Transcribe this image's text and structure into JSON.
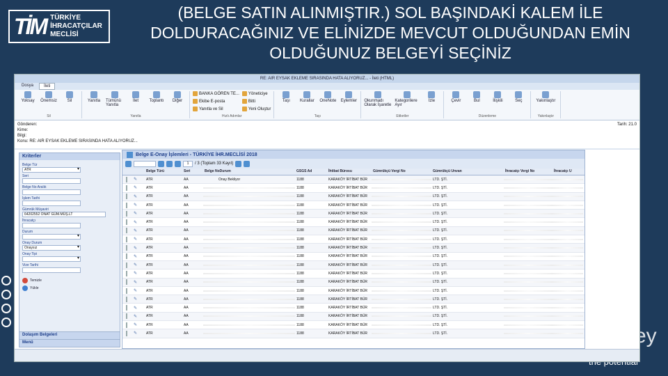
{
  "logo": {
    "mark": "TİM",
    "line1": "TÜRKİYE",
    "line2": "İHRACATÇILAR",
    "line3": "MECLİSİ"
  },
  "headline": "(BELGE SATIN ALINMIŞTIR.) SOL BAŞINDAKİ KALEM İLE DOLDURACAĞINIZ VE ELİNİZDE MEVCUT OLDUĞUNDAN EMİN OLDUĞUNUZ BELGEYİ SEÇİNİZ",
  "brand": {
    "word": "ey",
    "tagline": "the potential"
  },
  "app": {
    "window_title": "RE: AIR EYSAK EKLEME SIRASINDA HATA ALIYORUZ... - İleti (HTML)",
    "tabs": [
      {
        "label": "Dosya"
      },
      {
        "label": "İleti"
      }
    ],
    "ribbon": {
      "delete_group": {
        "label": "Sil",
        "buttons": [
          {
            "label": "Yoksay"
          },
          {
            "label": "Önemsiz"
          },
          {
            "label": "Sil"
          }
        ]
      },
      "reply_group": {
        "label": "Yanıtla",
        "buttons": [
          {
            "label": "Yanıtla"
          },
          {
            "label": "Tümünü Yanıtla"
          },
          {
            "label": "İlet"
          },
          {
            "label": "Toplantı"
          },
          {
            "label": "Diğer"
          }
        ]
      },
      "quick_group": {
        "label": "Hızlı Adımlar",
        "items": [
          "BANKA GÖREN TE...",
          "Ekibe E-posta",
          "Yanıtla ve Sil",
          "Yöneticiye",
          "Bitti",
          "Yeni Oluştur"
        ]
      },
      "move_group": {
        "label": "Taşı",
        "buttons": [
          {
            "label": "Taşı"
          },
          {
            "label": "Kurallar"
          },
          {
            "label": "OneNote"
          },
          {
            "label": "Eylemler"
          }
        ]
      },
      "tags_group": {
        "label": "Etiketler",
        "buttons": [
          {
            "label": "Okunmadı Olarak İşaretle"
          },
          {
            "label": "Kategorilere Ayır"
          },
          {
            "label": "İzle"
          }
        ]
      },
      "edit_group": {
        "label": "Düzenleme",
        "buttons": [
          {
            "label": "Çevir"
          },
          {
            "label": "Bul"
          },
          {
            "label": "İlişkili"
          },
          {
            "label": "Seç"
          }
        ]
      },
      "zoom_group": {
        "label": "Yakınlaştır",
        "buttons": [
          {
            "label": "Yakınlaştır"
          }
        ]
      }
    },
    "mail": {
      "from": "Gönderen:",
      "to": "Kime:",
      "cc": "Bilgi:",
      "subject_label": "Konu:",
      "subject": "RE: AIR EYSAK EKLEME SIRASINDA HATA ALIYORUZ...",
      "date": "Tarih: 21.0"
    },
    "left_panel": {
      "title": "Kriterler",
      "fields": [
        {
          "label": "Belge Tür",
          "value": "ATR",
          "type": "select"
        },
        {
          "label": "Seri",
          "value": "",
          "type": "input"
        },
        {
          "label": "Belge No Aralık",
          "value": "",
          "type": "input"
        },
        {
          "label": "İşlem Tarihi",
          "value": "",
          "type": "input"
        },
        {
          "label": "Gümrük Müşaviri",
          "value": "64202552 ONAT GÜM.MÜŞ.LT",
          "type": "wide"
        },
        {
          "label": "İhracatçı",
          "value": "",
          "type": "input"
        },
        {
          "label": "Durum",
          "value": "",
          "type": "select"
        },
        {
          "label": "Onay Durum",
          "value": "Onaysız",
          "type": "select"
        },
        {
          "label": "Onay Tipi",
          "value": "",
          "type": "select"
        },
        {
          "label": "Vize Tarihi",
          "value": "",
          "type": "input"
        }
      ],
      "clear_button": "Temizle",
      "load_button": "Yükle",
      "footer": [
        "Dolaşım Belgeleri",
        "Menü"
      ]
    },
    "grid": {
      "title": "Belge E-Onay İşlemleri - TÜRKİYE İHR.MECLİSİ 2018",
      "page": "1",
      "page_info": "/ 3 (Toplam 33 Kayıt)",
      "columns": [
        "",
        "",
        "Belge Türü",
        "Seri",
        "Belge No",
        "Durum",
        "GSGS Ad",
        "İhtibat Bürosu",
        "Gümrükçü Vergi No",
        "Gümrükçü Unvan",
        "İhracatçı Vergi No",
        "İhracatçı U"
      ],
      "first_row_status": "Onay Bekliyor",
      "rows": [
        {
          "type": "ATR",
          "seri": "AA",
          "gsgs": "1188",
          "buro": "KARAKÖY İRTİBAT BÜR",
          "unvan": "LTD. ŞTİ."
        },
        {
          "type": "ATR",
          "seri": "AA",
          "gsgs": "1188",
          "buro": "KARAKÖY İRTİBAT BÜR",
          "unvan": "LTD. ŞTİ."
        },
        {
          "type": "ATR",
          "seri": "AA",
          "gsgs": "1188",
          "buro": "KARAKÖY İRTİBAT BÜR",
          "unvan": "LTD. ŞTİ."
        },
        {
          "type": "ATR",
          "seri": "AA",
          "gsgs": "1188",
          "buro": "KARAKÖY İRTİBAT BÜR",
          "unvan": "LTD. ŞTİ."
        },
        {
          "type": "ATR",
          "seri": "AA",
          "gsgs": "1188",
          "buro": "KARAKÖY İRTİBAT BÜR",
          "unvan": "LTD. ŞTİ."
        },
        {
          "type": "ATR",
          "seri": "AA",
          "gsgs": "1188",
          "buro": "KARAKÖY İRTİBAT BÜR",
          "unvan": "LTD. ŞTİ."
        },
        {
          "type": "ATR",
          "seri": "AA",
          "gsgs": "1188",
          "buro": "KARAKÖY İRTİBAT BÜR",
          "unvan": "LTD. ŞTİ."
        },
        {
          "type": "ATR",
          "seri": "AA",
          "gsgs": "1188",
          "buro": "KARAKÖY İRTİBAT BÜR",
          "unvan": "LTD. ŞTİ."
        },
        {
          "type": "ATR",
          "seri": "AA",
          "gsgs": "1188",
          "buro": "KARAKÖY İRTİBAT BÜR",
          "unvan": "LTD. ŞTİ."
        },
        {
          "type": "ATR",
          "seri": "AA",
          "gsgs": "1188",
          "buro": "KARAKÖY İRTİBAT BÜR",
          "unvan": "LTD. ŞTİ."
        },
        {
          "type": "ATR",
          "seri": "AA",
          "gsgs": "1188",
          "buro": "KARAKÖY İRTİBAT BÜR",
          "unvan": "LTD. ŞTİ."
        },
        {
          "type": "ATR",
          "seri": "AA",
          "gsgs": "1188",
          "buro": "KARAKÖY İRTİBAT BÜR",
          "unvan": "LTD. ŞTİ."
        },
        {
          "type": "ATR",
          "seri": "AA",
          "gsgs": "1188",
          "buro": "KARAKÖY İRTİBAT BÜR",
          "unvan": "LTD. ŞTİ."
        },
        {
          "type": "ATR",
          "seri": "AA",
          "gsgs": "1188",
          "buro": "KARAKÖY İRTİBAT BÜR",
          "unvan": "LTD. ŞTİ."
        },
        {
          "type": "ATR",
          "seri": "AA",
          "gsgs": "1188",
          "buro": "KARAKÖY İRTİBAT BÜR",
          "unvan": "LTD. ŞTİ."
        },
        {
          "type": "ATR",
          "seri": "AA",
          "gsgs": "1188",
          "buro": "KARAKÖY İRTİBAT BÜR",
          "unvan": "LTD. ŞTİ."
        },
        {
          "type": "ATR",
          "seri": "AA",
          "gsgs": "1188",
          "buro": "KARAKÖY İRTİBAT BÜR",
          "unvan": "LTD. ŞTİ."
        },
        {
          "type": "ATR",
          "seri": "AA",
          "gsgs": "1188",
          "buro": "KARAKÖY İRTİBAT BÜR",
          "unvan": "LTD. ŞTİ."
        },
        {
          "type": "ATR",
          "seri": "AA",
          "gsgs": "1188",
          "buro": "KARAKÖY İRTİBAT BÜR",
          "unvan": "LTD. ŞTİ."
        }
      ]
    }
  }
}
